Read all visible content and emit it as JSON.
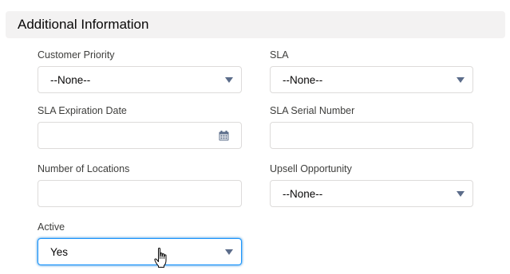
{
  "section": {
    "title": "Additional Information"
  },
  "fields": {
    "customer_priority": {
      "label": "Customer Priority",
      "value": "--None--"
    },
    "sla": {
      "label": "SLA",
      "value": "--None--"
    },
    "sla_expiration_date": {
      "label": "SLA Expiration Date",
      "value": ""
    },
    "sla_serial_number": {
      "label": "SLA Serial Number",
      "value": ""
    },
    "number_of_locations": {
      "label": "Number of Locations",
      "value": ""
    },
    "upsell_opportunity": {
      "label": "Upsell Opportunity",
      "value": "--None--"
    },
    "active": {
      "label": "Active",
      "value": "Yes"
    }
  },
  "icons": {
    "dropdown": "chevron-down-icon",
    "date": "calendar-icon",
    "pointer": "hand-cursor-icon"
  },
  "colors": {
    "section_background": "#f3f2f2",
    "input_border": "#dddbda",
    "focus_border": "#1b96ff",
    "caret": "#5b6c8a",
    "text": "#080707",
    "label": "#3e3e3c"
  }
}
